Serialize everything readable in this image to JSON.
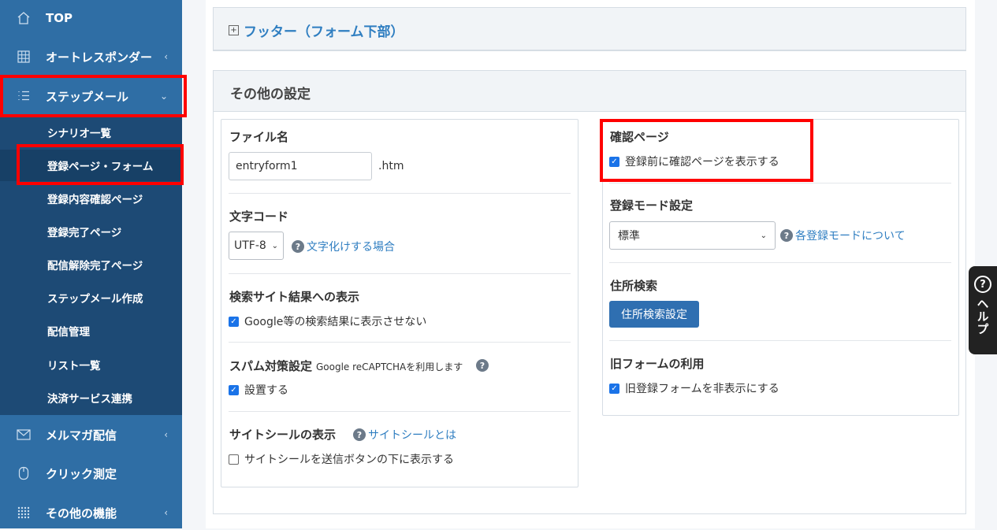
{
  "sidebar": {
    "items": [
      {
        "label": "TOP",
        "icon": "home-icon"
      },
      {
        "label": "オートレスポンダー",
        "icon": "grid-icon"
      },
      {
        "label": "ステップメール",
        "icon": "list-icon"
      },
      {
        "label": "メルマガ配信",
        "icon": "mail-icon"
      },
      {
        "label": "クリック測定",
        "icon": "mouse-icon"
      },
      {
        "label": "その他の機能",
        "icon": "dots-grid-icon"
      }
    ],
    "submenu": [
      "シナリオ一覧",
      "登録ページ・フォーム",
      "登録内容確認ページ",
      "登録完了ページ",
      "配信解除完了ページ",
      "ステップメール作成",
      "配信管理",
      "リスト一覧",
      "決済サービス連携"
    ]
  },
  "footer_panel": {
    "label": "フッター（フォーム下部）"
  },
  "settings": {
    "title": "その他の設定",
    "file_name": {
      "label": "ファイル名",
      "value": "entryform1",
      "ext": ".htm"
    },
    "charset": {
      "label": "文字コード",
      "selected": "UTF-8",
      "help": "文字化けする場合"
    },
    "search": {
      "label": "検索サイト結果への表示",
      "checkbox": "Google等の検索結果に表示させない"
    },
    "spam": {
      "label": "スパム対策設定",
      "note": "Google reCAPTCHAを利用します",
      "checkbox": "設置する"
    },
    "site_seal": {
      "label": "サイトシールの表示",
      "help": "サイトシールとは",
      "checkbox": "サイトシールを送信ボタンの下に表示する"
    },
    "confirm": {
      "label": "確認ページ",
      "checkbox": "登録前に確認ページを表示する"
    },
    "mode": {
      "label": "登録モード設定",
      "selected": "標準",
      "help": "各登録モードについて"
    },
    "address": {
      "label": "住所検索",
      "button": "住所検索設定"
    },
    "old_form": {
      "label": "旧フォームの利用",
      "checkbox": "旧登録フォームを非表示にする"
    }
  },
  "help_tab": {
    "label": "ヘルプ"
  },
  "colors": {
    "sidebar": "#2f6ea5",
    "submenu": "#1d4a75",
    "highlight": "#ff0000",
    "link": "#2f7ec1",
    "button": "#2f6fb1"
  }
}
